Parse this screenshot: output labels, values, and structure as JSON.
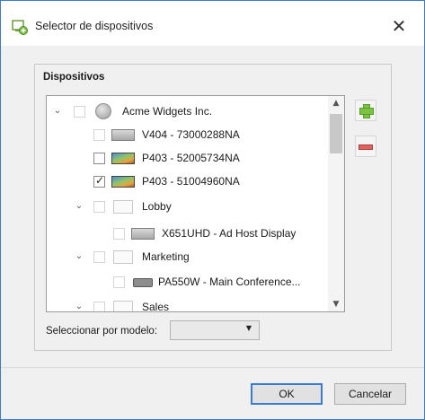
{
  "window": {
    "title": "Selector de dispositivos",
    "close_glyph": "✕",
    "icon": "device-picker-icon",
    "accent_color": "#3a7bd5"
  },
  "devices_group": {
    "label": "Dispositivos",
    "tree": [
      {
        "label": "Acme Widgets Inc.",
        "kind": "organization",
        "expander": "⌄",
        "checked": false
      },
      {
        "label": "V404 - 73000288NA",
        "kind": "display",
        "checked": false
      },
      {
        "label": "P403 - 52005734NA",
        "kind": "display",
        "checked": false
      },
      {
        "label": "P403 - 51004960NA",
        "kind": "display",
        "checked": true
      },
      {
        "label": "Lobby",
        "kind": "folder",
        "expander": "⌄",
        "checked": false
      },
      {
        "label": "X651UHD - Ad Host Display",
        "kind": "display",
        "checked": false
      },
      {
        "label": "Marketing",
        "kind": "folder",
        "expander": "⌄",
        "checked": false
      },
      {
        "label": "PA550W - Main Conference...",
        "kind": "projector",
        "checked": false
      },
      {
        "label": "Sales",
        "kind": "folder",
        "expander": "⌄",
        "checked": false
      }
    ],
    "add_button_icon": "plus-icon",
    "remove_button_icon": "minus-icon",
    "scroll_up_glyph": "▲",
    "scroll_down_glyph": "▼"
  },
  "model_filter": {
    "label": "Seleccionar por modelo:",
    "value": "",
    "arrow_glyph": "▼"
  },
  "footer": {
    "ok_label": "OK",
    "cancel_label": "Cancelar"
  },
  "check_glyph": "✓"
}
